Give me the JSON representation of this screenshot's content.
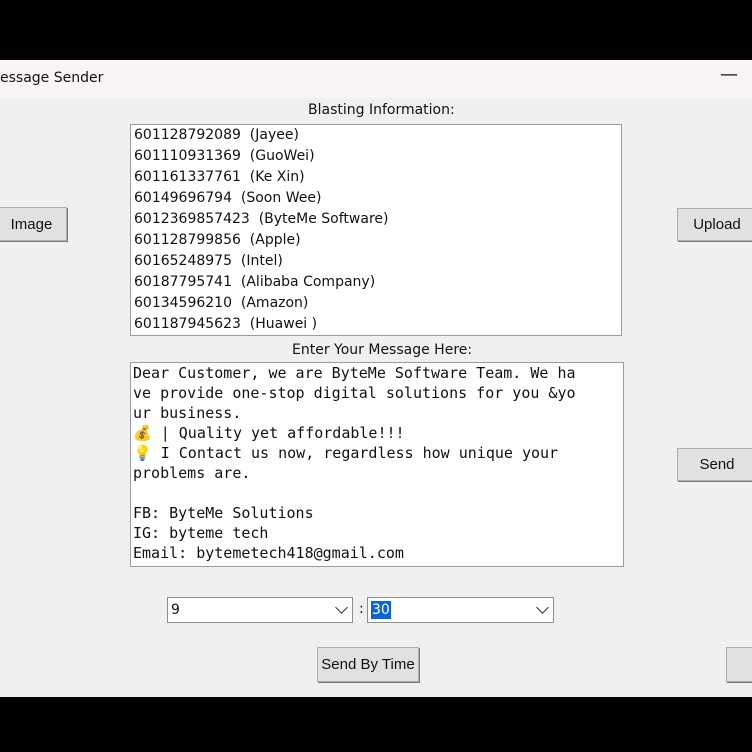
{
  "window": {
    "title": "essage Sender",
    "minimize_glyph": "—"
  },
  "labels": {
    "blasting_info": "Blasting Information:",
    "enter_message": "Enter Your Message Here:",
    "colon": ":"
  },
  "buttons": {
    "image": "Image",
    "upload": "Upload",
    "send": "Send",
    "send_by_time": "Send By Time",
    "right_edge": ""
  },
  "recipients": [
    {
      "phone": "601128792089",
      "name": "(Jayee)"
    },
    {
      "phone": "601110931369",
      "name": "(GuoWei)"
    },
    {
      "phone": "601161337761",
      "name": "(Ke Xin)"
    },
    {
      "phone": "60149696794",
      "name": "(Soon Wee)"
    },
    {
      "phone": "6012369857423",
      "name": "(ByteMe Software)"
    },
    {
      "phone": "601128799856",
      "name": "(Apple)"
    },
    {
      "phone": "60165248975",
      "name": "(Intel)"
    },
    {
      "phone": "60187795741",
      "name": "(Alibaba Company)"
    },
    {
      "phone": "60134596210",
      "name": "(Amazon)"
    },
    {
      "phone": "601187945623",
      "name": "(Huawei )"
    }
  ],
  "message_lines": [
    "Dear Customer, we are ByteMe Software Team. We ha",
    "ve provide one-stop digital solutions for you &yo",
    "ur business.",
    "💰 | Quality yet affordable!!!",
    "💡 I Contact us now, regardless how unique your",
    "problems are.",
    "",
    "FB: ByteMe Solutions",
    "IG: byteme tech",
    "Email: bytemetech418@gmail.com"
  ],
  "time": {
    "hour": "9",
    "minute": "30"
  }
}
